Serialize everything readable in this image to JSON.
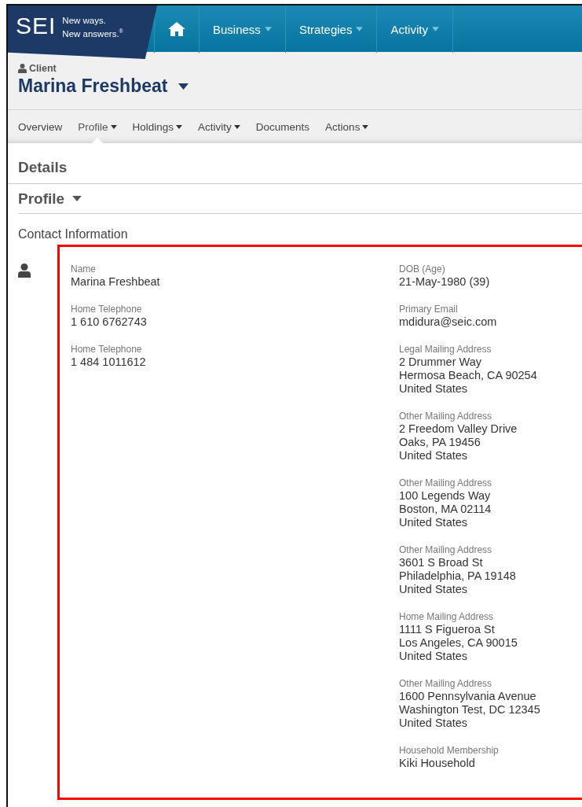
{
  "header": {
    "logo": {
      "mark": "SEI",
      "tagline": [
        "New ways.",
        "New answers.$^{®}$"
      ]
    },
    "nav": [
      {
        "kind": "home"
      },
      {
        "kind": "menu",
        "label": "Business"
      },
      {
        "kind": "menu",
        "label": "Strategies"
      },
      {
        "kind": "menu",
        "label": "Activity"
      }
    ]
  },
  "client": {
    "label": "Client",
    "name": "Marina Freshbeat"
  },
  "tabs": [
    {
      "label": "Overview",
      "dropdown": false,
      "selected": false
    },
    {
      "label": "Profile",
      "dropdown": true,
      "selected": true
    },
    {
      "label": "Holdings",
      "dropdown": true,
      "selected": false
    },
    {
      "label": "Activity",
      "dropdown": true,
      "selected": false
    },
    {
      "label": "Documents",
      "dropdown": false,
      "selected": false
    },
    {
      "label": "Actions",
      "dropdown": true,
      "selected": false
    }
  ],
  "details_title": "Details",
  "profile_title": "Profile",
  "contact_title": "Contact Information",
  "left_fields": [
    {
      "label": "Name",
      "lines": [
        "Marina Freshbeat"
      ]
    },
    {
      "label": "Home Telephone",
      "lines": [
        "1 610 6762743"
      ]
    },
    {
      "label": "Home Telephone",
      "lines": [
        "1 484 1011612"
      ]
    }
  ],
  "right_fields": [
    {
      "label": "DOB (Age)",
      "lines": [
        "21-May-1980 (39)"
      ]
    },
    {
      "label": "Primary Email",
      "lines": [
        "mdidura@seic.com"
      ]
    },
    {
      "label": "Legal Mailing Address",
      "lines": [
        "2 Drummer Way",
        "Hermosa Beach, CA 90254",
        "United States"
      ]
    },
    {
      "label": "Other Mailing Address",
      "lines": [
        "2 Freedom Valley Drive",
        "Oaks, PA 19456",
        "United States"
      ]
    },
    {
      "label": "Other Mailing Address",
      "lines": [
        "100 Legends Way",
        "Boston, MA 02114",
        "United States"
      ]
    },
    {
      "label": "Other Mailing Address",
      "lines": [
        "3601 S Broad St",
        "Philadelphia, PA 19148",
        "United States"
      ]
    },
    {
      "label": "Home Mailing Address",
      "lines": [
        "1111 S Figueroa St",
        "Los Angeles, CA 90015",
        "United States"
      ]
    },
    {
      "label": "Other Mailing Address",
      "lines": [
        "1600 Pennsylvania Avenue",
        "Washington Test, DC 12345",
        "United States"
      ]
    },
    {
      "label": "Household Membership",
      "lines": [
        "Kiki Household"
      ]
    }
  ]
}
